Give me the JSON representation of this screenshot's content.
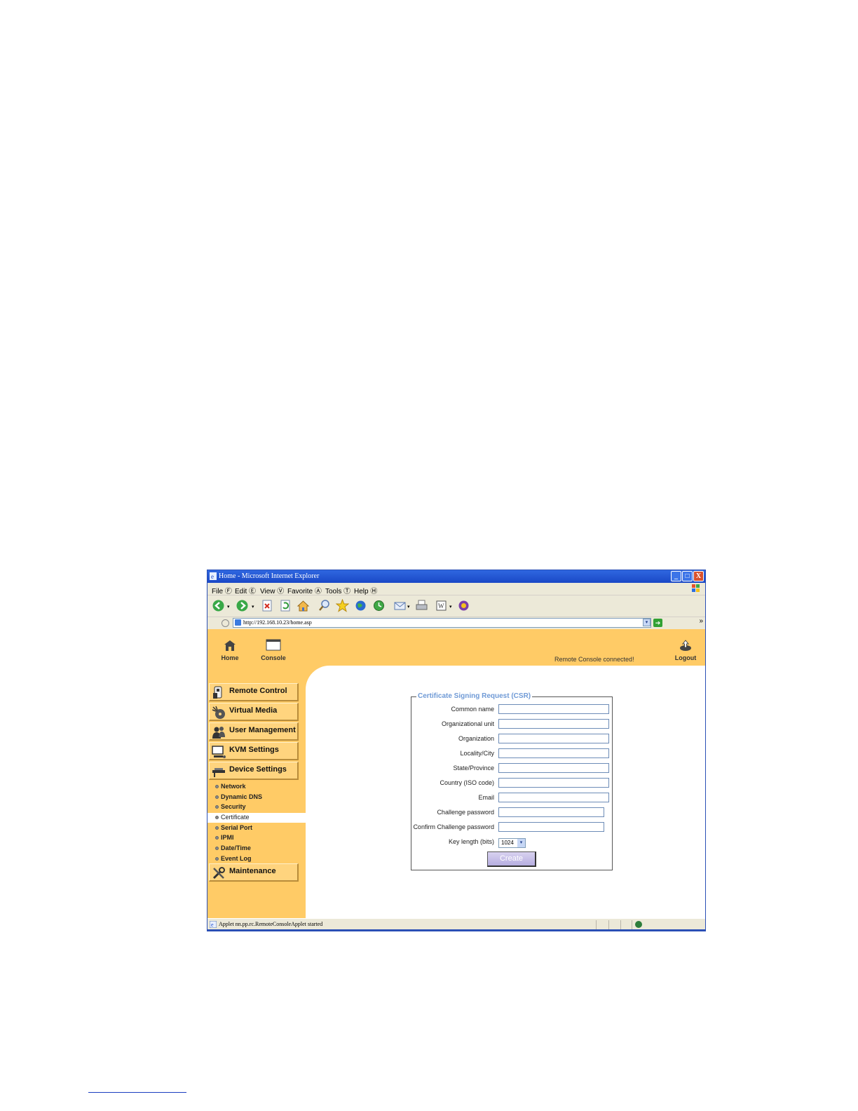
{
  "window": {
    "title": "Home - Microsoft Internet Explorer",
    "controls": {
      "minimize": "_",
      "maximize": "□",
      "close": "X"
    }
  },
  "menubar": {
    "items": [
      "File Ⓕ",
      "Edit Ⓔ",
      "View Ⓥ",
      "Favorite Ⓐ",
      "Tools Ⓣ",
      "Help Ⓗ"
    ]
  },
  "toolbar": {
    "icons": [
      "back-icon",
      "forward-icon",
      "stop-icon",
      "refresh-icon",
      "home-icon",
      "search-icon",
      "favorites-icon",
      "media-icon",
      "history-icon",
      "mail-icon",
      "print-icon",
      "edit-icon",
      "messenger-icon"
    ]
  },
  "address": {
    "label": "Ⓓ",
    "url": "http://192.168.10.23/home.asp",
    "more": "»"
  },
  "topnav": {
    "home_label": "Home",
    "console_label": "Console",
    "logout_label": "Logout",
    "status": "Remote Console connected!"
  },
  "sidebar": {
    "buttons": [
      {
        "label": "Remote Control"
      },
      {
        "label": "Virtual Media"
      },
      {
        "label": "User Management"
      },
      {
        "label": "KVM Settings"
      },
      {
        "label": "Device Settings"
      }
    ],
    "sub_items": [
      {
        "label": "Network"
      },
      {
        "label": "Dynamic DNS"
      },
      {
        "label": "Security"
      },
      {
        "label": "Certificate",
        "active": true
      },
      {
        "label": "Serial Port"
      },
      {
        "label": "IPMI"
      },
      {
        "label": "Date/Time"
      },
      {
        "label": "Event Log"
      }
    ],
    "maintenance_label": "Maintenance"
  },
  "csr_form": {
    "legend": "Certificate Signing Request (CSR)",
    "fields": [
      {
        "label": "Common name",
        "value": ""
      },
      {
        "label": "Organizational unit",
        "value": ""
      },
      {
        "label": "Organization",
        "value": ""
      },
      {
        "label": "Locality/City",
        "value": ""
      },
      {
        "label": "State/Province",
        "value": ""
      },
      {
        "label": "Country (ISO code)",
        "value": ""
      },
      {
        "label": "Email",
        "value": ""
      },
      {
        "label": "Challenge password",
        "value": ""
      },
      {
        "label": "Confirm Challenge password",
        "value": ""
      }
    ],
    "key_length_label": "Key length (bits)",
    "key_length_value": "1024",
    "create_label": "Create"
  },
  "statusbar": {
    "text": "Applet nn.pp.rc.RemoteConsoleApplet started"
  },
  "colors": {
    "content_bg": "#ffcb66",
    "legend_text": "#6f9ad6",
    "titlebar": "#1a48c6"
  }
}
